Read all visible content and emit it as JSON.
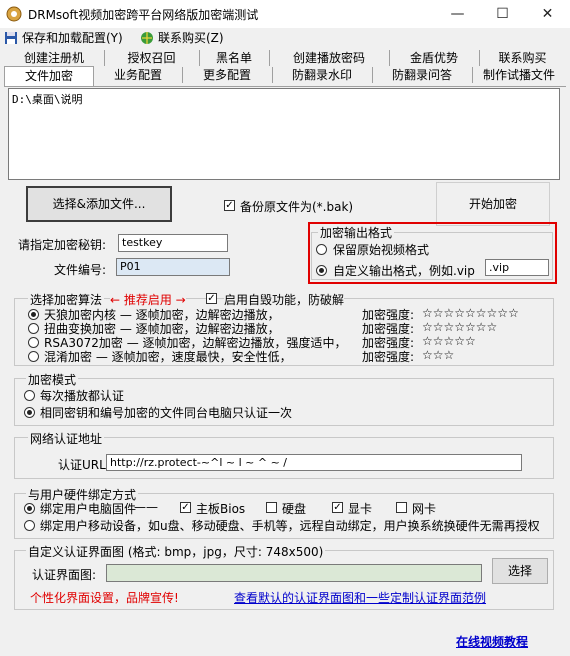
{
  "window": {
    "title": "DRMsoft视频加密跨平台网络版加密端测试",
    "minimize_glyph": "—",
    "maximize_glyph": "☐",
    "close_glyph": "✕"
  },
  "menu": {
    "items": [
      {
        "label": "保存和加载配置(Y)",
        "icon": "save-disk-icon"
      },
      {
        "label": "联系购买(Z)",
        "icon": "contact-globe-icon"
      }
    ]
  },
  "tabs": {
    "row1": [
      "创建注册机",
      "授权召回",
      "黑名单",
      "创建播放密码",
      "金盾优势",
      "联系购买"
    ],
    "row2": [
      "文件加密",
      "业务配置",
      "更多配置",
      "防翻录水印",
      "防翻录问答",
      "制作试播文件"
    ],
    "active": "文件加密"
  },
  "file_list": {
    "path": "D:\\桌面\\说明"
  },
  "actions": {
    "select_files_label": "选择&添加文件...",
    "backup_label": "备份原文件为(*.bak)",
    "backup_checked": true,
    "start_label": "开始加密"
  },
  "key": {
    "label": "请指定加密秘钥:",
    "value": "testkey"
  },
  "file_no": {
    "label": "文件编号:",
    "value": "P01"
  },
  "output_format": {
    "title": "加密输出格式",
    "keep_label": "保留原始视频格式",
    "custom_label": "自定义输出格式，例如.vip",
    "custom_value": ".vip",
    "selected": "custom"
  },
  "algorithm": {
    "title": "选择加密算法",
    "recommend": "← 推荐启用 →",
    "self_protect_label": "启用自毁功能，防破解",
    "self_protect_checked": true,
    "strength_label": "加密强度:",
    "options": [
      {
        "label": "天狼加密内核 — 逐帧加密，边解密边播放，",
        "stars": "☆☆☆☆☆☆☆☆☆",
        "selected": true
      },
      {
        "label": "扭曲变换加密 — 逐帧加密，边解密边播放，",
        "stars": "☆☆☆☆☆☆☆",
        "selected": false
      },
      {
        "label": "RSA3072加密 — 逐帧加密，边解密边播放，强度适中，",
        "stars": "☆☆☆☆☆",
        "selected": false
      },
      {
        "label": "混淆加密 — 逐帧加密，速度最快，安全性低，",
        "stars": "☆☆☆",
        "selected": false
      }
    ]
  },
  "mode": {
    "title": "加密模式",
    "options": [
      {
        "label": "每次播放都认证",
        "selected": false
      },
      {
        "label": "相同密钥和编号加密的文件同台电脑只认证一次",
        "selected": true
      }
    ]
  },
  "network": {
    "title": "网络认证地址",
    "url_label": "认证URL:",
    "url_value": "http://rz.protect-~^l     ~   l   ~ ^   ~ /"
  },
  "binding": {
    "title": "与用户硬件绑定方式",
    "pc_label": "绑定用户电脑固件",
    "dash": "——",
    "pc_selected": true,
    "hardware": [
      {
        "label": "主板Bios",
        "checked": true
      },
      {
        "label": "硬盘",
        "checked": false
      },
      {
        "label": "显卡",
        "checked": true
      },
      {
        "label": "网卡",
        "checked": false
      }
    ],
    "mobile_label": "绑定用户移动设备，如u盘、移动硬盘、手机等，远程自动绑定，用户换系统换硬件无需再授权"
  },
  "auth_ui": {
    "title": "自定义认证界面图 (格式: bmp，jpg，尺寸: 748x500)",
    "field_label": "认证界面图:",
    "field_value": "",
    "select_label": "选择",
    "promo": "个性化界面设置，品牌宣传!",
    "sample_link": "查看默认的认证界面图和一些定制认证界面范例"
  },
  "footer": {
    "tutorial_link": "在线视频教程"
  },
  "colors": {
    "highlight_border": "#e00000",
    "promo_text": "#e00000",
    "link": "#0000cc",
    "field_fill": "#dbe8d6",
    "file_no_fill": "#dce8f4"
  }
}
